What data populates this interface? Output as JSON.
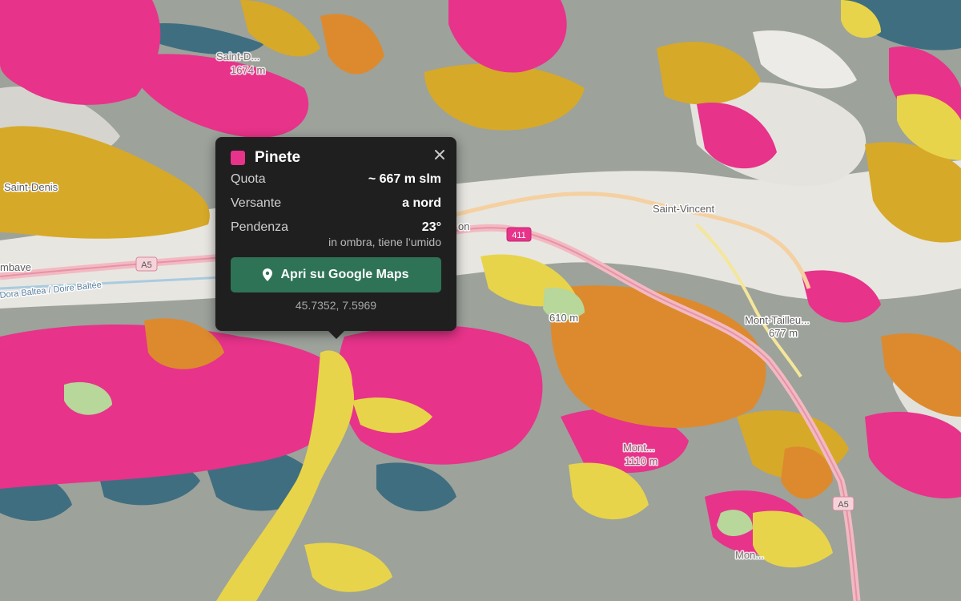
{
  "popup": {
    "title": "Pinete",
    "swatch_color": "#e7338a",
    "close_icon": "close-icon",
    "rows": [
      {
        "label": "Quota",
        "value": "~ 667 m slm"
      },
      {
        "label": "Versante",
        "value": "a nord"
      },
      {
        "label": "Pendenza",
        "value": "23°"
      }
    ],
    "note": "in ombra, tiene l’umido",
    "button_label": "Apri su Google Maps",
    "button_icon": "map-pin-icon",
    "button_color": "#2e7356",
    "coordinates": "45.7352, 7.5969"
  },
  "map": {
    "labels": {
      "saint_denis": "Saint-Denis",
      "saint_vincent": "Saint-Vincent",
      "peak_top": "Saint-D...",
      "peak_top_elev": "1674 m",
      "chambave": "mbave",
      "on": "on",
      "elev_610": "610 m",
      "mont_tailleur": "Mont-Tailleu...",
      "elev_677": "677 m",
      "dora": "Dora Baltea / Doire Baltée",
      "monte_bottom": "Mont...",
      "monte_elev": "1110 m",
      "mont_right": "Mon..."
    },
    "shields": {
      "a5_left": "A5",
      "a5_right": "A5",
      "road_411": "411"
    },
    "legend_colors": {
      "pinete": "#e7338a",
      "yellow": "#e8d44a",
      "orange": "#dd8a2e",
      "gold": "#d7a928",
      "teal": "#3f6e80",
      "grey_green": "#8f9d93",
      "light_green": "#b7d79b"
    }
  }
}
